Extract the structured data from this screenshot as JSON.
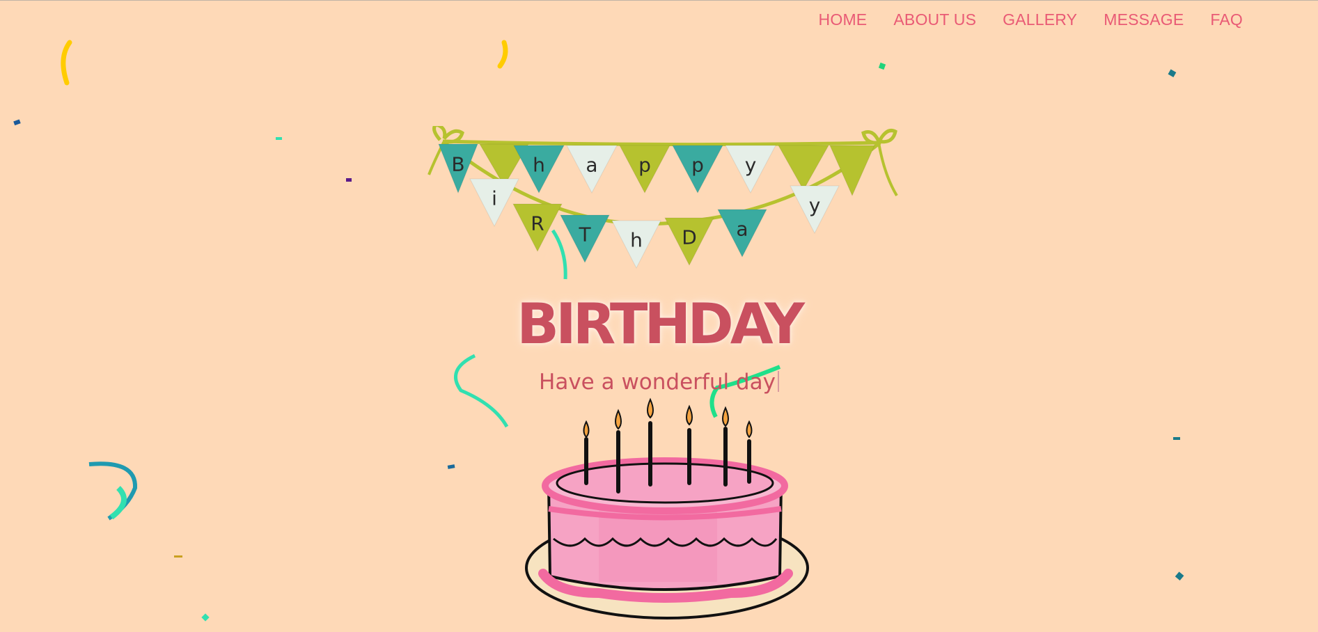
{
  "nav": {
    "items": [
      {
        "label": "HOME"
      },
      {
        "label": "ABOUT US"
      },
      {
        "label": "GALLERY"
      },
      {
        "label": "MESSAGE"
      },
      {
        "label": "FAQ"
      }
    ]
  },
  "hero": {
    "banner_letters_top": [
      "B",
      "h",
      "a",
      "p",
      "p",
      "y"
    ],
    "banner_letters_bottom": [
      "i",
      "R",
      "T",
      "h",
      "D",
      "a",
      "y"
    ],
    "title": "BIRTHDAY",
    "subtitle": "Have a wonderful day"
  },
  "icons": {
    "banner": "happy-birthday-bunting-icon",
    "cake": "birthday-cake-icon",
    "confetti": "confetti-icon"
  },
  "colors": {
    "background": "#fed9b7",
    "nav_link": "#e95a75",
    "title": "#c9505f",
    "flag_teal": "#3aaba0",
    "flag_lime": "#b6c22f",
    "flag_white": "#e6efe8",
    "cake_pink": "#f6a3c4"
  }
}
